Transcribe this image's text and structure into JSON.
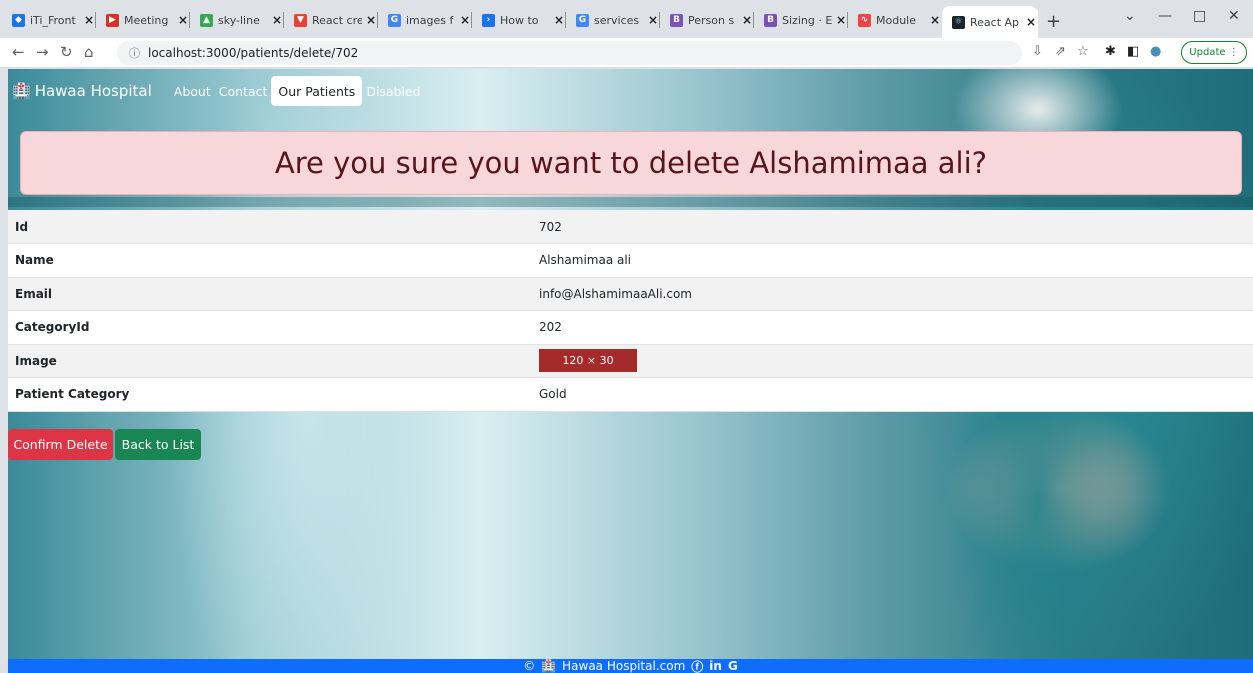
{
  "browser": {
    "tabs": [
      {
        "title": "iTi_Front",
        "favicon_color": "#1a73e8",
        "favicon_glyph": "◆"
      },
      {
        "title": "Meeting",
        "favicon_color": "#d93025",
        "favicon_glyph": "▶"
      },
      {
        "title": "sky-line",
        "favicon_color": "#34a853",
        "favicon_glyph": "▲"
      },
      {
        "title": "React cre",
        "favicon_color": "#e94234",
        "favicon_glyph": "▼"
      },
      {
        "title": "images f",
        "favicon_color": "#4285f4",
        "favicon_glyph": "G"
      },
      {
        "title": "How to",
        "favicon_color": "#1a73e8",
        "favicon_glyph": "›"
      },
      {
        "title": "services",
        "favicon_color": "#4285f4",
        "favicon_glyph": "G"
      },
      {
        "title": "Person s",
        "favicon_color": "#7952b3",
        "favicon_glyph": "B"
      },
      {
        "title": "Sizing · E",
        "favicon_color": "#7952b3",
        "favicon_glyph": "B"
      },
      {
        "title": "Module",
        "favicon_color": "#ef4444",
        "favicon_glyph": "∿"
      },
      {
        "title": "React Ap",
        "favicon_color": "#20232a",
        "favicon_glyph": "⚛"
      }
    ],
    "url": "localhost:3000/patients/delete/702",
    "update_label": "Update"
  },
  "navbar": {
    "brand": "Hawaa Hospital",
    "links": [
      "About",
      "Contact",
      "Our Patients",
      "Disabled"
    ]
  },
  "alert": {
    "message": "Are you sure you want to delete Alshamimaa ali?"
  },
  "details": {
    "rows": [
      {
        "label": "Id",
        "value": "702"
      },
      {
        "label": "Name",
        "value": "Alshamimaa ali"
      },
      {
        "label": "Email",
        "value": "info@AlshamimaaAli.com"
      },
      {
        "label": "CategoryId",
        "value": "202"
      },
      {
        "label": "Image",
        "value": "120 × 30"
      },
      {
        "label": "Patient Category",
        "value": "Gold"
      }
    ]
  },
  "actions": {
    "confirm_label": "Confirm Delete",
    "back_label": "Back to List"
  },
  "footer": {
    "copyright": "©",
    "site": "Hawaa Hospital.com",
    "icons": [
      "facebook-icon",
      "linkedin-icon",
      "google-icon"
    ]
  },
  "colors": {
    "alert_bg": "#f8d7da",
    "alert_text": "#58151c",
    "danger": "#dc3545",
    "success": "#198754",
    "footer": "#0d6efd",
    "image_placeholder": "#a52a2a"
  }
}
